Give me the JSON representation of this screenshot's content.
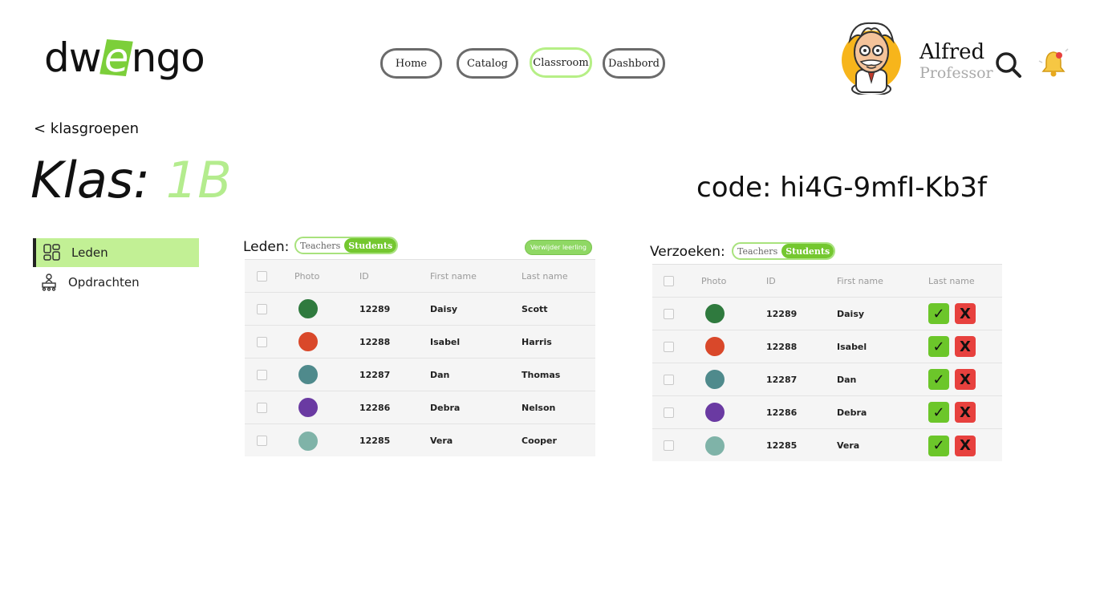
{
  "brand": {
    "logo_pre": "dw",
    "logo_e": "e",
    "logo_post": "ngo",
    "accent": "#74c72f",
    "accent_light": "#c2f095"
  },
  "nav": [
    {
      "label": "Home",
      "active": false
    },
    {
      "label": "Catalog",
      "active": false
    },
    {
      "label": "Classroom",
      "active": true
    },
    {
      "label": "Dashbord",
      "active": false
    }
  ],
  "profile": {
    "name": "Alfred",
    "role": "Professor",
    "avatar_icon": "professor-avatar-icon"
  },
  "header_icons": {
    "search": "search-icon",
    "bell": "bell-icon"
  },
  "page": {
    "back_link": "< klasgroepen",
    "klas_label": "Klas: ",
    "klas_value": "1B",
    "code_line": "code: hi4G-9mfI-Kb3f"
  },
  "sidebar": {
    "items": [
      {
        "label": "Leden",
        "icon": "members-grid-icon",
        "active": true
      },
      {
        "label": "Opdrachten",
        "icon": "assignments-icon",
        "active": false
      }
    ]
  },
  "members": {
    "label": "Leden:",
    "toggle": [
      "Teachers",
      "Students"
    ],
    "remove_button": "Verwijder leerling",
    "columns": [
      "Photo",
      "ID",
      "First name",
      "Last name"
    ],
    "rows": [
      {
        "id": "12289",
        "first": "Daisy",
        "last": "Scott",
        "color": "#2f7a3e"
      },
      {
        "id": "12288",
        "first": "Isabel",
        "last": "Harris",
        "color": "#d9482a"
      },
      {
        "id": "12287",
        "first": "Dan",
        "last": "Thomas",
        "color": "#4f8a8c"
      },
      {
        "id": "12286",
        "first": "Debra",
        "last": "Nelson",
        "color": "#6a3aa2"
      },
      {
        "id": "12285",
        "first": "Vera",
        "last": "Cooper",
        "color": "#7fb3a8"
      }
    ]
  },
  "requests": {
    "label": "Verzoeken:",
    "toggle": [
      "Teachers",
      "Students"
    ],
    "columns": [
      "Photo",
      "ID",
      "First name",
      "Last name"
    ],
    "accept_glyph": "✓",
    "reject_glyph": "X",
    "rows": [
      {
        "id": "12289",
        "first": "Daisy",
        "color": "#2f7a3e"
      },
      {
        "id": "12288",
        "first": "Isabel",
        "color": "#d9482a"
      },
      {
        "id": "12287",
        "first": "Dan",
        "color": "#4f8a8c"
      },
      {
        "id": "12286",
        "first": "Debra",
        "color": "#6a3aa2"
      },
      {
        "id": "12285",
        "first": "Vera",
        "color": "#7fb3a8"
      }
    ]
  }
}
